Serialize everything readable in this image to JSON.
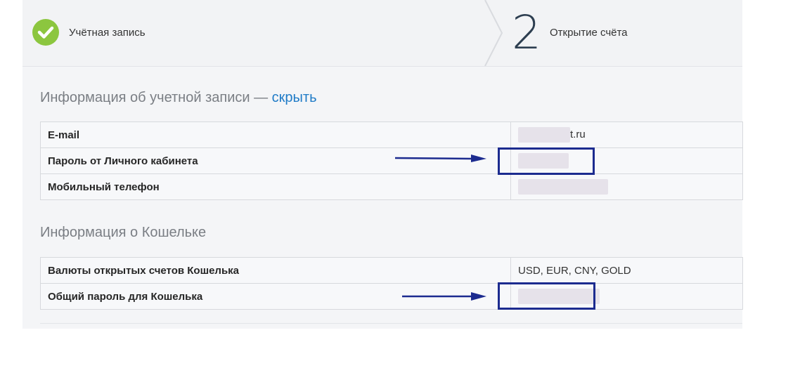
{
  "steps": {
    "step1": {
      "label": "Учётная запись",
      "icon": "check-circle-icon",
      "status": "done",
      "color": "#8cc63f"
    },
    "step2": {
      "number": "2",
      "label": "Открытие счёта"
    }
  },
  "account_section": {
    "title": "Информация об учетной записи — ",
    "hide_link": "скрыть",
    "rows": [
      {
        "label": "E-mail",
        "value_suffix": "t.ru"
      },
      {
        "label": "Пароль от Личного кабинета",
        "value_suffix": ""
      },
      {
        "label": "Мобильный телефон",
        "value_suffix": ""
      }
    ]
  },
  "wallet_section": {
    "title": "Информация о Кошельке",
    "rows": [
      {
        "label": "Валюты открытых счетов Кошелька",
        "value": "USD, EUR, CNY, GOLD"
      },
      {
        "label": "Общий пароль для Кошелька",
        "value": ""
      }
    ]
  },
  "colors": {
    "accent_link": "#1f7bc7",
    "highlight": "#1c2b8f",
    "check": "#8cc63f"
  }
}
